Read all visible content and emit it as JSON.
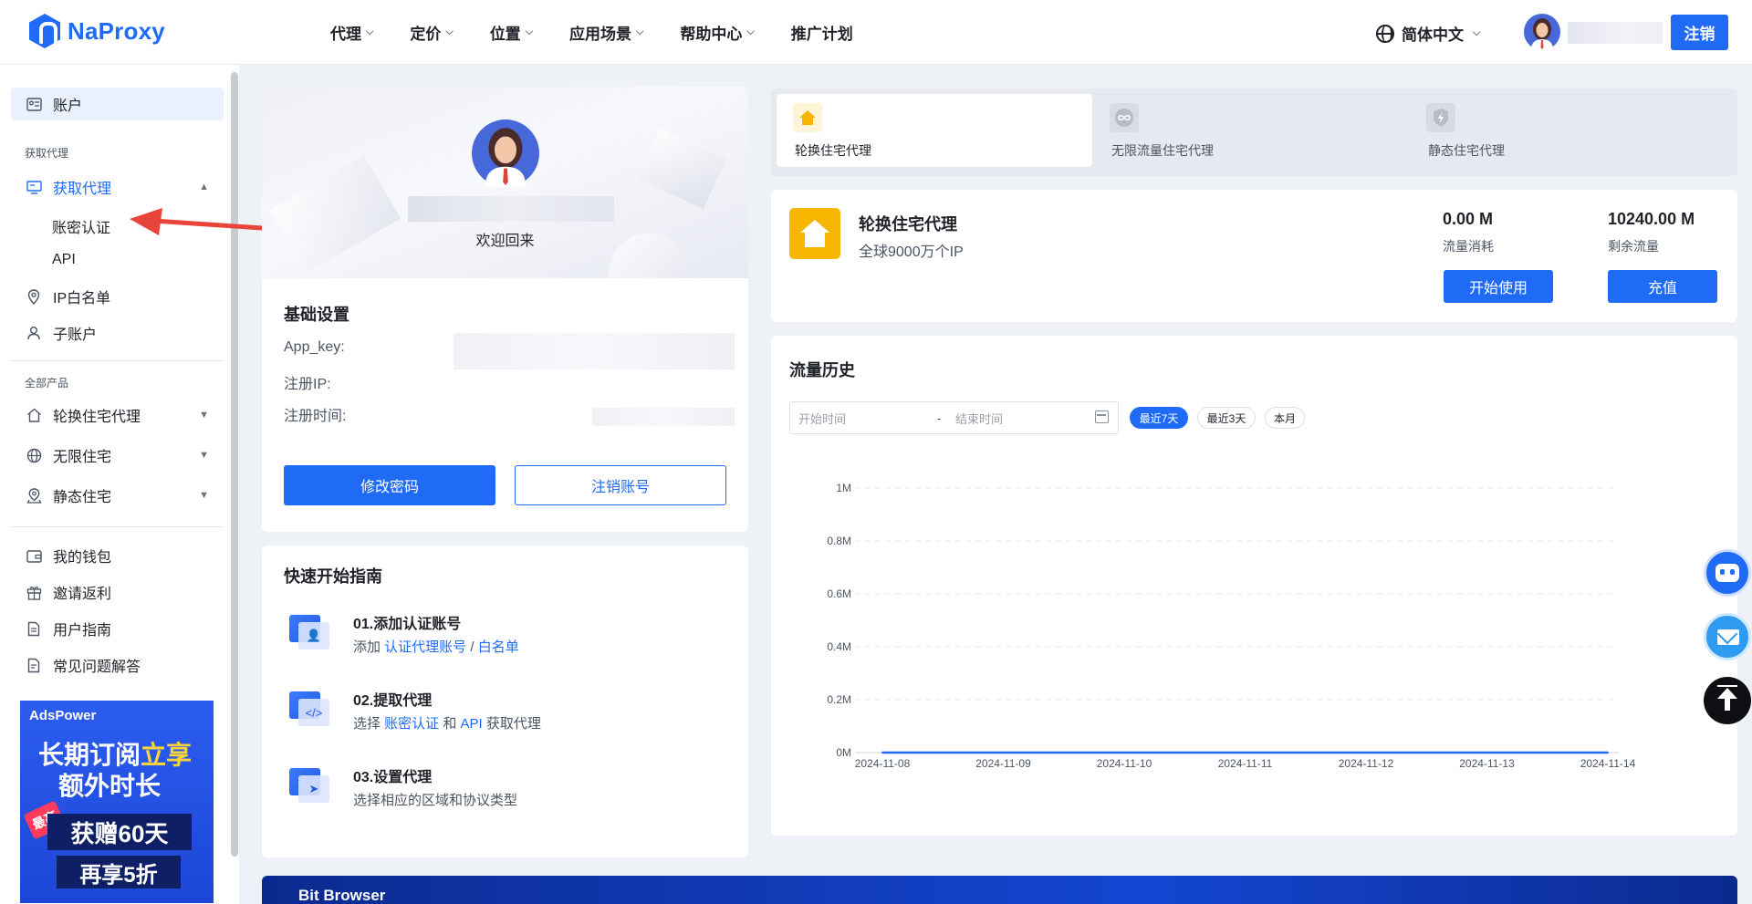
{
  "brand": {
    "name": "NaProxy"
  },
  "nav": {
    "items": [
      {
        "label": "代理"
      },
      {
        "label": "定价"
      },
      {
        "label": "位置"
      },
      {
        "label": "应用场景"
      },
      {
        "label": "帮助中心"
      },
      {
        "label": "推广计划"
      }
    ],
    "language": "简体中文",
    "logout": "注销"
  },
  "sidebar": {
    "account": "账户",
    "section_get_proxy": "获取代理",
    "get_proxy": "获取代理",
    "sub_password_auth": "账密认证",
    "sub_api": "API",
    "ip_whitelist": "IP白名单",
    "sub_account": "子账户",
    "section_all_products": "全部产品",
    "rotating_residential": "轮换住宅代理",
    "unlimited_residential": "无限住宅",
    "static_residential": "静态住宅",
    "wallet": "我的钱包",
    "invite": "邀请返利",
    "user_guide": "用户指南",
    "faq": "常见问题解答"
  },
  "ad": {
    "brand": "AdsPower",
    "line1_a": "长期订阅",
    "line1_b": "立享",
    "line2": "额外时长",
    "badge": "最高",
    "box1": "获赠60天",
    "box2": "再享5折"
  },
  "profile": {
    "welcome": "欢迎回来"
  },
  "basic": {
    "title": "基础设置",
    "app_key": "App_key:",
    "reg_ip": "注册IP:",
    "reg_time": "注册时间:",
    "change_password": "修改密码",
    "delete_account": "注销账号"
  },
  "guide": {
    "title": "快速开始指南",
    "steps": [
      {
        "title": "01.添加认证账号",
        "pre": "添加 ",
        "link1": "认证代理账号",
        "mid": " / ",
        "link2": "白名单",
        "post": ""
      },
      {
        "title": "02.提取代理",
        "pre": "选择 ",
        "link1": "账密认证",
        "mid": " 和 ",
        "link2": "API",
        "post": " 获取代理"
      },
      {
        "title": "03.设置代理",
        "desc": "选择相应的区域和协议类型"
      }
    ]
  },
  "product_tabs": [
    {
      "label": "轮换住宅代理",
      "icon": "house-icon",
      "color": "#f7b500"
    },
    {
      "label": "无限流量住宅代理",
      "icon": "infinity-icon",
      "color": "#9aa0a8"
    },
    {
      "label": "静态住宅代理",
      "icon": "shield-bolt-icon",
      "color": "#9aa0a8"
    }
  ],
  "product": {
    "name": "轮换住宅代理",
    "subtitle": "全球9000万个IP",
    "used_value": "0.00 M",
    "used_label": "流量消耗",
    "remain_value": "10240.00 M",
    "remain_label": "剩余流量",
    "start_button": "开始使用",
    "recharge_button": "充值"
  },
  "history": {
    "title": "流量历史",
    "start_placeholder": "开始时间",
    "dash": "-",
    "end_placeholder": "结束时间",
    "filters": [
      {
        "label": "最近7天",
        "active": true
      },
      {
        "label": "最近3天",
        "active": false
      },
      {
        "label": "本月",
        "active": false
      }
    ]
  },
  "chart_data": {
    "type": "line",
    "categories": [
      "2024-11-08",
      "2024-11-09",
      "2024-11-10",
      "2024-11-11",
      "2024-11-12",
      "2024-11-13",
      "2024-11-14"
    ],
    "values": [
      0,
      0,
      0,
      0,
      0,
      0,
      0
    ],
    "y_ticks": [
      "0M",
      "0.2M",
      "0.4M",
      "0.6M",
      "0.8M",
      "1M"
    ],
    "ylim": [
      0,
      1
    ],
    "grid": true,
    "line_color": "#1f6bf5"
  },
  "bottom_banner": {
    "brand": "Bit Browser"
  }
}
